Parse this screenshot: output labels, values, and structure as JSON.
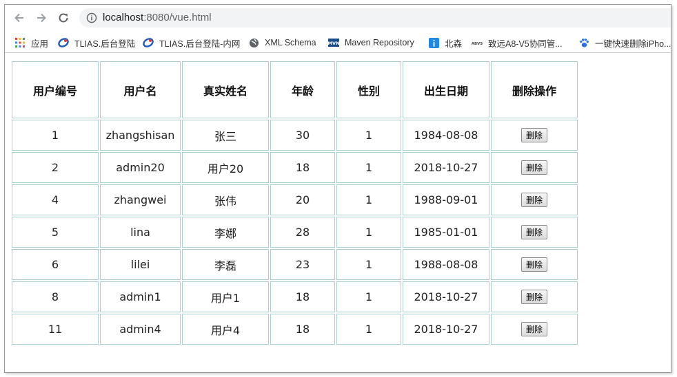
{
  "browser": {
    "url_host": "localhost",
    "url_rest": ":8080/vue.html"
  },
  "bookmarks": [
    {
      "label": "应用",
      "icon": "apps-grid-icon"
    },
    {
      "label": "TLIAS.后台登陆",
      "icon": "tlias-logo-icon"
    },
    {
      "label": "TLIAS.后台登陆-内网",
      "icon": "tlias-logo-icon"
    },
    {
      "label": "XML Schema",
      "icon": "globe-icon"
    },
    {
      "label": "Maven Repository",
      "icon": "maven-logo-icon"
    },
    {
      "label": "北森",
      "icon": "beisen-logo-icon"
    },
    {
      "label": "致远A8-V5协同管...",
      "icon": "seeyon-logo-icon"
    },
    {
      "label": "一键快速删除iPho...",
      "icon": "paw-icon"
    }
  ],
  "table": {
    "headers": [
      "用户编号",
      "用户名",
      "真实姓名",
      "年龄",
      "性别",
      "出生日期",
      "删除操作"
    ],
    "delete_label": "删除",
    "rows": [
      {
        "id": "1",
        "username": "zhangshisan",
        "realname": "张三",
        "age": "30",
        "gender": "1",
        "birthday": "1984-08-08"
      },
      {
        "id": "2",
        "username": "admin20",
        "realname": "用户20",
        "age": "18",
        "gender": "1",
        "birthday": "2018-10-27"
      },
      {
        "id": "4",
        "username": "zhangwei",
        "realname": "张伟",
        "age": "20",
        "gender": "1",
        "birthday": "1988-09-01"
      },
      {
        "id": "5",
        "username": "lina",
        "realname": "李娜",
        "age": "28",
        "gender": "1",
        "birthday": "1985-01-01"
      },
      {
        "id": "6",
        "username": "lilei",
        "realname": "李磊",
        "age": "23",
        "gender": "1",
        "birthday": "1988-08-08"
      },
      {
        "id": "8",
        "username": "admin1",
        "realname": "用户1",
        "age": "18",
        "gender": "1",
        "birthday": "2018-10-27"
      },
      {
        "id": "11",
        "username": "admin4",
        "realname": "用户4",
        "age": "18",
        "gender": "1",
        "birthday": "2018-10-27"
      }
    ]
  }
}
